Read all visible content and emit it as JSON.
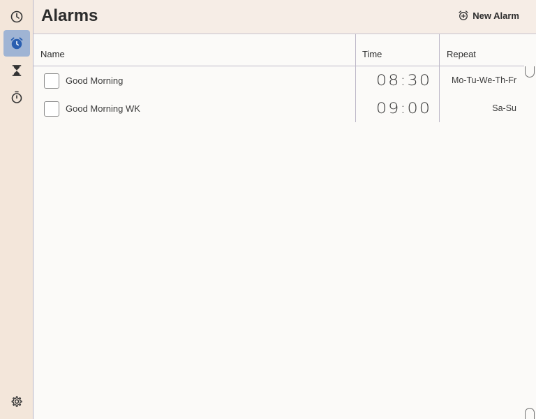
{
  "header": {
    "title": "Alarms",
    "new_alarm_label": "New Alarm"
  },
  "sidebar": {
    "items": [
      {
        "icon": "clock-icon",
        "active": false
      },
      {
        "icon": "alarm-clock-icon",
        "active": true
      },
      {
        "icon": "hourglass-icon",
        "active": false
      },
      {
        "icon": "stopwatch-icon",
        "active": false
      }
    ],
    "settings_icon": "gear-icon"
  },
  "table": {
    "columns": [
      "Name",
      "Time",
      "Repeat"
    ],
    "rows": [
      {
        "name": "Good Morning",
        "time": "08:30",
        "repeat": "Mo-Tu-We-Th-Fr",
        "checked": false
      },
      {
        "name": "Good Morning WK",
        "time": "09:00",
        "repeat": "Sa-Su",
        "checked": false
      }
    ]
  },
  "colors": {
    "sidebar_bg": "#f3e6da",
    "active_nav": "#9fb4d4",
    "accent": "#2a5fb0"
  }
}
